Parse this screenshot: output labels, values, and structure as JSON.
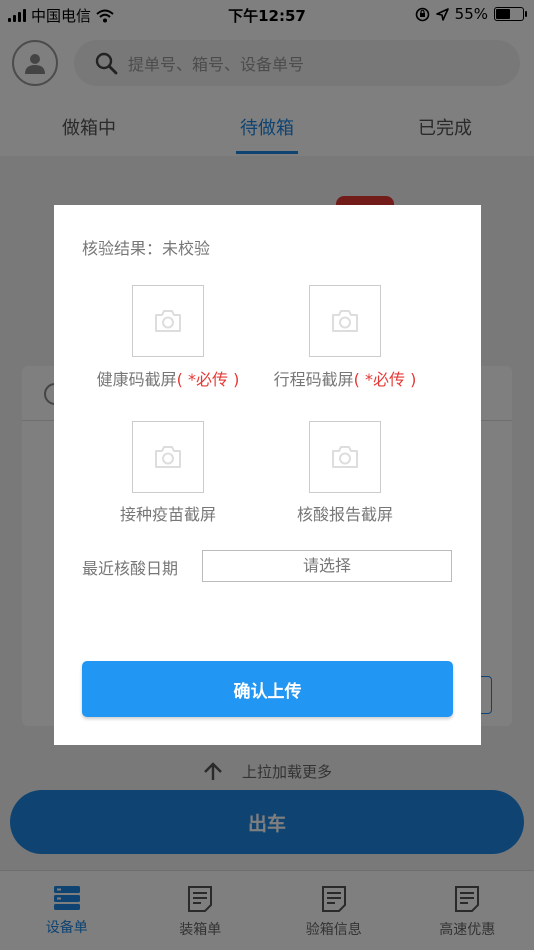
{
  "status_bar": {
    "carrier": "中国电信",
    "time": "下午12:57",
    "battery": "55%",
    "battery_level": 0.55
  },
  "header": {
    "search_placeholder": "提单号、箱号、设备单号"
  },
  "tabs": [
    {
      "label": "做箱中"
    },
    {
      "label": "待做箱"
    },
    {
      "label": "已完成"
    }
  ],
  "load_more": "上拉加载更多",
  "depart_label": "出车",
  "bottom_nav": [
    {
      "label": "设备单",
      "icon": "device-list-icon"
    },
    {
      "label": "装箱单",
      "icon": "document-icon"
    },
    {
      "label": "验箱信息",
      "icon": "document-icon"
    },
    {
      "label": "高速优惠",
      "icon": "document-icon"
    }
  ],
  "modal": {
    "verify_label": "核验结果：",
    "verify_value": "未校验",
    "uploads": [
      {
        "label": "健康码截屏",
        "required": "( *必传 )"
      },
      {
        "label": "行程码截屏",
        "required": "( *必传 )"
      },
      {
        "label": "接种疫苗截屏",
        "required": ""
      },
      {
        "label": "核酸报告截屏",
        "required": ""
      }
    ],
    "date_label": "最近核酸日期",
    "date_placeholder": "请选择",
    "confirm_label": "确认上传"
  },
  "colors": {
    "accent": "#1e88e5",
    "confirm": "#2196f3",
    "required": "#e53935"
  }
}
